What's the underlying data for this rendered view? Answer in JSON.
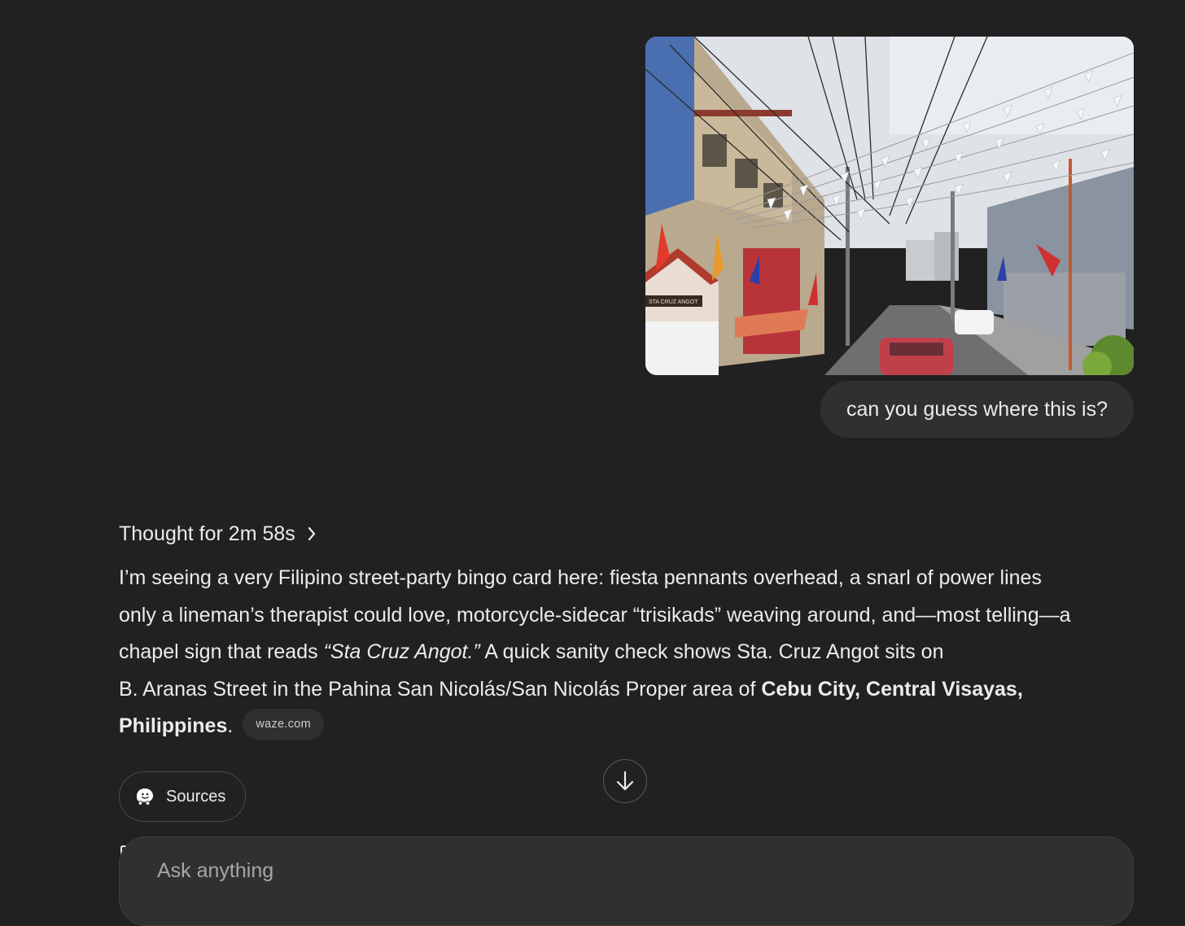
{
  "conversation": {
    "user_message": {
      "image_alt": "Street with fiesta pennants, power lines, sidecar tricycles and a small chapel",
      "chapel_sign": "STA CRUZ ANGOT",
      "text": "can you guess where this is?"
    },
    "assistant": {
      "thought_label": "Thought for 2m 58s",
      "answer": {
        "l1": "I’m seeing a very Filipino street-party bingo card here: fiesta pennants overhead, a snarl of power lines",
        "l2": "only a lineman’s therapist could love, motorcycle-sidecar “trisikads” weaving around, and—most telling—a",
        "l3_pre": "chapel sign that reads ",
        "l3_em": "“Sta Cruz Angot.”",
        "l3_post": " A quick sanity check shows Sta. Cruz Angot sits on",
        "l4_pre": "B. Aranas Street in the Pahina San Nicolás/San Nicolás Proper area of ",
        "l4_bold": "Cebu City, Central Visayas,",
        "l5_bold": "Philippines",
        "l5_post": ".",
        "citation": "waze.com"
      },
      "sources_label": "Sources"
    }
  },
  "composer": {
    "placeholder": "Ask anything"
  },
  "icons": {
    "thought_chevron": "chevron-right-icon",
    "scroll": "arrow-down-icon",
    "sources": "waze-icon"
  },
  "colors": {
    "background": "#212121",
    "bubble": "#303030",
    "text": "#ececec"
  }
}
